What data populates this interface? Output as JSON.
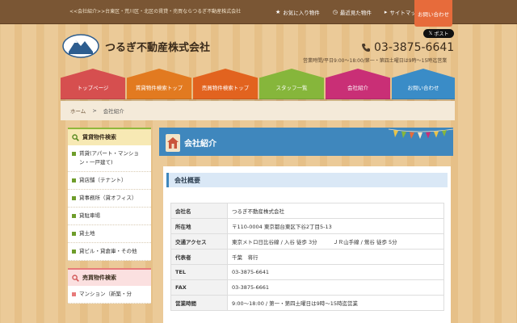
{
  "topbar": {
    "tagline": "<<会社紹介>>台東区・荒川区・北区の賃貸・売買ならつるぎ不動産株式会社",
    "links": [
      {
        "icon": "star-icon",
        "glyph": "★",
        "label": "お気に入り物件"
      },
      {
        "icon": "clock-icon",
        "glyph": "◷",
        "label": "最近見た物件"
      },
      {
        "icon": "sitemap-icon",
        "glyph": "▸",
        "label": "サイトマップ"
      }
    ],
    "contact_label": "お問い合わせ"
  },
  "header": {
    "site_title": "つるぎ不動産株式会社",
    "x_post_label": "ポスト",
    "phone": "03-3875-6641",
    "hours": "営業時間/平日9:00～18:00/第一・第四土曜日は9時～15時迄営業"
  },
  "nav": {
    "items": [
      {
        "label": "トップページ",
        "color": "#d64f4f"
      },
      {
        "label": "賃貸物件検索トップ",
        "color": "#e27a20"
      },
      {
        "label": "売買物件検索トップ",
        "color": "#e2631f"
      },
      {
        "label": "スタッフ一覧",
        "color": "#86b63b"
      },
      {
        "label": "会社紹介",
        "color": "#c92f76"
      },
      {
        "label": "お問い合わせ",
        "color": "#3a8cc7"
      }
    ]
  },
  "breadcrumb": {
    "home": "ホーム",
    "separator": ">",
    "current": "会社紹介"
  },
  "sidebar": {
    "rent_heading": "賃貸物件検索",
    "rent_items": [
      "賃貸(アパート・マンション・一戸建て)",
      "貸店舗（テナント）",
      "貸事務所（貸オフィス）",
      "貸駐車場",
      "貸土地",
      "貸ビル・貸倉庫・その他"
    ],
    "sale_heading": "売買物件検索",
    "sale_items": [
      "マンション（新築・分"
    ]
  },
  "main": {
    "title": "会社紹介",
    "section_heading": "会社概要",
    "rows": [
      {
        "label": "会社名",
        "value": "つるぎ不動産株式会社"
      },
      {
        "label": "所在地",
        "value": "〒110-0004 東京都台東区下谷2丁目5-13"
      },
      {
        "label": "交通アクセス",
        "value": "東京メトロ日比谷線 / 入谷 徒歩 3分　　　ＪＲ山手線 / 鶯谷 徒歩 5分"
      },
      {
        "label": "代表者",
        "value": "千葉　将行"
      },
      {
        "label": "TEL",
        "value": "03-3875-6641"
      },
      {
        "label": "FAX",
        "value": "03-3875-6661"
      },
      {
        "label": "営業時間",
        "value": "9:00～18:00 / 第一・第四土曜日は9時～15時迄営業"
      }
    ]
  },
  "colors": {
    "topbar": "#7a5634",
    "contact_tab": "#e76b3b",
    "main_title": "#3f87bd",
    "sidebar_rent_accent": "#8fb83c",
    "sidebar_sale_accent": "#e77a7a"
  }
}
